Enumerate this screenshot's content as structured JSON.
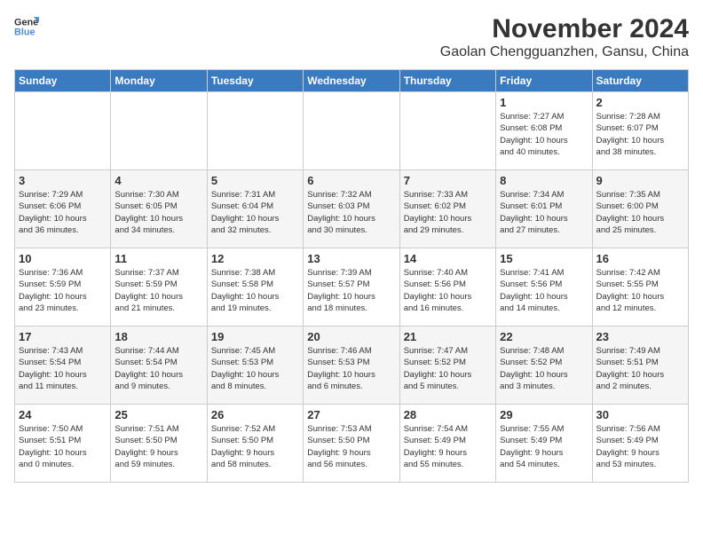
{
  "header": {
    "logo_line1": "General",
    "logo_line2": "Blue",
    "month_year": "November 2024",
    "location": "Gaolan Chengguanzhen, Gansu, China"
  },
  "weekdays": [
    "Sunday",
    "Monday",
    "Tuesday",
    "Wednesday",
    "Thursday",
    "Friday",
    "Saturday"
  ],
  "weeks": [
    [
      {
        "day": "",
        "info": ""
      },
      {
        "day": "",
        "info": ""
      },
      {
        "day": "",
        "info": ""
      },
      {
        "day": "",
        "info": ""
      },
      {
        "day": "",
        "info": ""
      },
      {
        "day": "1",
        "info": "Sunrise: 7:27 AM\nSunset: 6:08 PM\nDaylight: 10 hours\nand 40 minutes."
      },
      {
        "day": "2",
        "info": "Sunrise: 7:28 AM\nSunset: 6:07 PM\nDaylight: 10 hours\nand 38 minutes."
      }
    ],
    [
      {
        "day": "3",
        "info": "Sunrise: 7:29 AM\nSunset: 6:06 PM\nDaylight: 10 hours\nand 36 minutes."
      },
      {
        "day": "4",
        "info": "Sunrise: 7:30 AM\nSunset: 6:05 PM\nDaylight: 10 hours\nand 34 minutes."
      },
      {
        "day": "5",
        "info": "Sunrise: 7:31 AM\nSunset: 6:04 PM\nDaylight: 10 hours\nand 32 minutes."
      },
      {
        "day": "6",
        "info": "Sunrise: 7:32 AM\nSunset: 6:03 PM\nDaylight: 10 hours\nand 30 minutes."
      },
      {
        "day": "7",
        "info": "Sunrise: 7:33 AM\nSunset: 6:02 PM\nDaylight: 10 hours\nand 29 minutes."
      },
      {
        "day": "8",
        "info": "Sunrise: 7:34 AM\nSunset: 6:01 PM\nDaylight: 10 hours\nand 27 minutes."
      },
      {
        "day": "9",
        "info": "Sunrise: 7:35 AM\nSunset: 6:00 PM\nDaylight: 10 hours\nand 25 minutes."
      }
    ],
    [
      {
        "day": "10",
        "info": "Sunrise: 7:36 AM\nSunset: 5:59 PM\nDaylight: 10 hours\nand 23 minutes."
      },
      {
        "day": "11",
        "info": "Sunrise: 7:37 AM\nSunset: 5:59 PM\nDaylight: 10 hours\nand 21 minutes."
      },
      {
        "day": "12",
        "info": "Sunrise: 7:38 AM\nSunset: 5:58 PM\nDaylight: 10 hours\nand 19 minutes."
      },
      {
        "day": "13",
        "info": "Sunrise: 7:39 AM\nSunset: 5:57 PM\nDaylight: 10 hours\nand 18 minutes."
      },
      {
        "day": "14",
        "info": "Sunrise: 7:40 AM\nSunset: 5:56 PM\nDaylight: 10 hours\nand 16 minutes."
      },
      {
        "day": "15",
        "info": "Sunrise: 7:41 AM\nSunset: 5:56 PM\nDaylight: 10 hours\nand 14 minutes."
      },
      {
        "day": "16",
        "info": "Sunrise: 7:42 AM\nSunset: 5:55 PM\nDaylight: 10 hours\nand 12 minutes."
      }
    ],
    [
      {
        "day": "17",
        "info": "Sunrise: 7:43 AM\nSunset: 5:54 PM\nDaylight: 10 hours\nand 11 minutes."
      },
      {
        "day": "18",
        "info": "Sunrise: 7:44 AM\nSunset: 5:54 PM\nDaylight: 10 hours\nand 9 minutes."
      },
      {
        "day": "19",
        "info": "Sunrise: 7:45 AM\nSunset: 5:53 PM\nDaylight: 10 hours\nand 8 minutes."
      },
      {
        "day": "20",
        "info": "Sunrise: 7:46 AM\nSunset: 5:53 PM\nDaylight: 10 hours\nand 6 minutes."
      },
      {
        "day": "21",
        "info": "Sunrise: 7:47 AM\nSunset: 5:52 PM\nDaylight: 10 hours\nand 5 minutes."
      },
      {
        "day": "22",
        "info": "Sunrise: 7:48 AM\nSunset: 5:52 PM\nDaylight: 10 hours\nand 3 minutes."
      },
      {
        "day": "23",
        "info": "Sunrise: 7:49 AM\nSunset: 5:51 PM\nDaylight: 10 hours\nand 2 minutes."
      }
    ],
    [
      {
        "day": "24",
        "info": "Sunrise: 7:50 AM\nSunset: 5:51 PM\nDaylight: 10 hours\nand 0 minutes."
      },
      {
        "day": "25",
        "info": "Sunrise: 7:51 AM\nSunset: 5:50 PM\nDaylight: 9 hours\nand 59 minutes."
      },
      {
        "day": "26",
        "info": "Sunrise: 7:52 AM\nSunset: 5:50 PM\nDaylight: 9 hours\nand 58 minutes."
      },
      {
        "day": "27",
        "info": "Sunrise: 7:53 AM\nSunset: 5:50 PM\nDaylight: 9 hours\nand 56 minutes."
      },
      {
        "day": "28",
        "info": "Sunrise: 7:54 AM\nSunset: 5:49 PM\nDaylight: 9 hours\nand 55 minutes."
      },
      {
        "day": "29",
        "info": "Sunrise: 7:55 AM\nSunset: 5:49 PM\nDaylight: 9 hours\nand 54 minutes."
      },
      {
        "day": "30",
        "info": "Sunrise: 7:56 AM\nSunset: 5:49 PM\nDaylight: 9 hours\nand 53 minutes."
      }
    ]
  ]
}
